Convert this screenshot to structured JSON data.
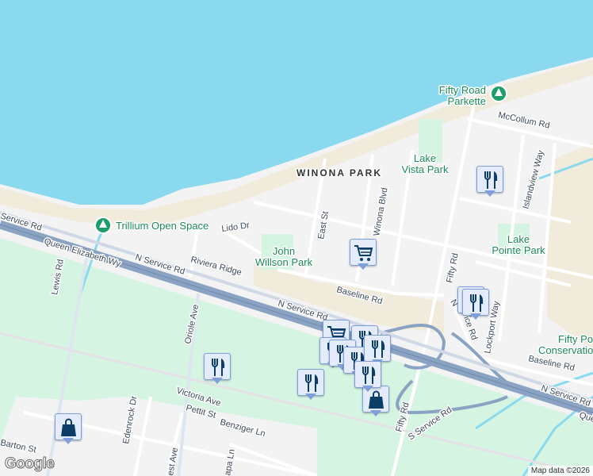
{
  "map": {
    "colors": {
      "water": "#8ad9ee",
      "land": "#f3f3f4",
      "green": "#d5f5e2",
      "beach": "#f1ebdc",
      "highway": "#8aa3c2",
      "road": "#ffffff",
      "marker_icon": "#0b3d66"
    },
    "neighborhoods": [
      {
        "label": "WINONA PARK"
      }
    ],
    "parks": [
      {
        "label": "Trillium Open Space"
      },
      {
        "label_line1": "John",
        "label_line2": "Willson Park"
      },
      {
        "label_line1": "Fifty Road",
        "label_line2": "Parkette"
      },
      {
        "label_line1": "Lake",
        "label_line2": "Vista Park"
      },
      {
        "label_line1": "Lake",
        "label_line2": "Pointe Park"
      },
      {
        "label_line1": "Fifty Po",
        "label_line2": "Conservatio"
      }
    ],
    "roads": [
      "Service Rd",
      "Queen Elizabeth Wy",
      "N Service Rd",
      "Lido Dr",
      "Riviera Ridge",
      "Lewis Rd",
      "Oriole Ave",
      "Victoria Ave",
      "Pettit St",
      "Benziger Ln",
      "Edenrock Dr",
      "Barton St",
      "East St",
      "Winona Blvd",
      "Baseline Rd",
      "Fifty Rd",
      "McCollum Rd",
      "Islandview Way",
      "Lockport Way",
      "N Service Rd",
      "Baseline Rd",
      "N Service Rd",
      "Que",
      "Fifty Rd",
      "S Service Rd",
      "est Ave",
      "apa Ln",
      "N",
      "ice Rd",
      "N Service Rd"
    ],
    "markers": [
      {
        "type": "restaurant",
        "icon": "fork-knife-icon"
      },
      {
        "type": "grocery",
        "icon": "shopping-cart-icon"
      },
      {
        "type": "restaurant",
        "icon": "fork-knife-icon"
      },
      {
        "type": "restaurant",
        "icon": "fork-knife-icon"
      },
      {
        "type": "restaurant",
        "icon": "fork-knife-icon"
      },
      {
        "type": "grocery",
        "icon": "shopping-cart-icon"
      },
      {
        "type": "restaurant",
        "icon": "fork-knife-icon"
      },
      {
        "type": "restaurant",
        "icon": "fork-knife-icon"
      },
      {
        "type": "restaurant",
        "icon": "fork-knife-icon"
      },
      {
        "type": "restaurant",
        "icon": "fork-knife-icon"
      },
      {
        "type": "restaurant",
        "icon": "fork-knife-icon"
      },
      {
        "type": "restaurant",
        "icon": "fork-knife-icon"
      },
      {
        "type": "shopping",
        "icon": "shopping-bag-icon"
      },
      {
        "type": "restaurant",
        "icon": "fork-knife-icon"
      },
      {
        "type": "shopping",
        "icon": "shopping-bag-icon"
      }
    ],
    "logo": "Google",
    "attribution": "Map data ©2026"
  }
}
